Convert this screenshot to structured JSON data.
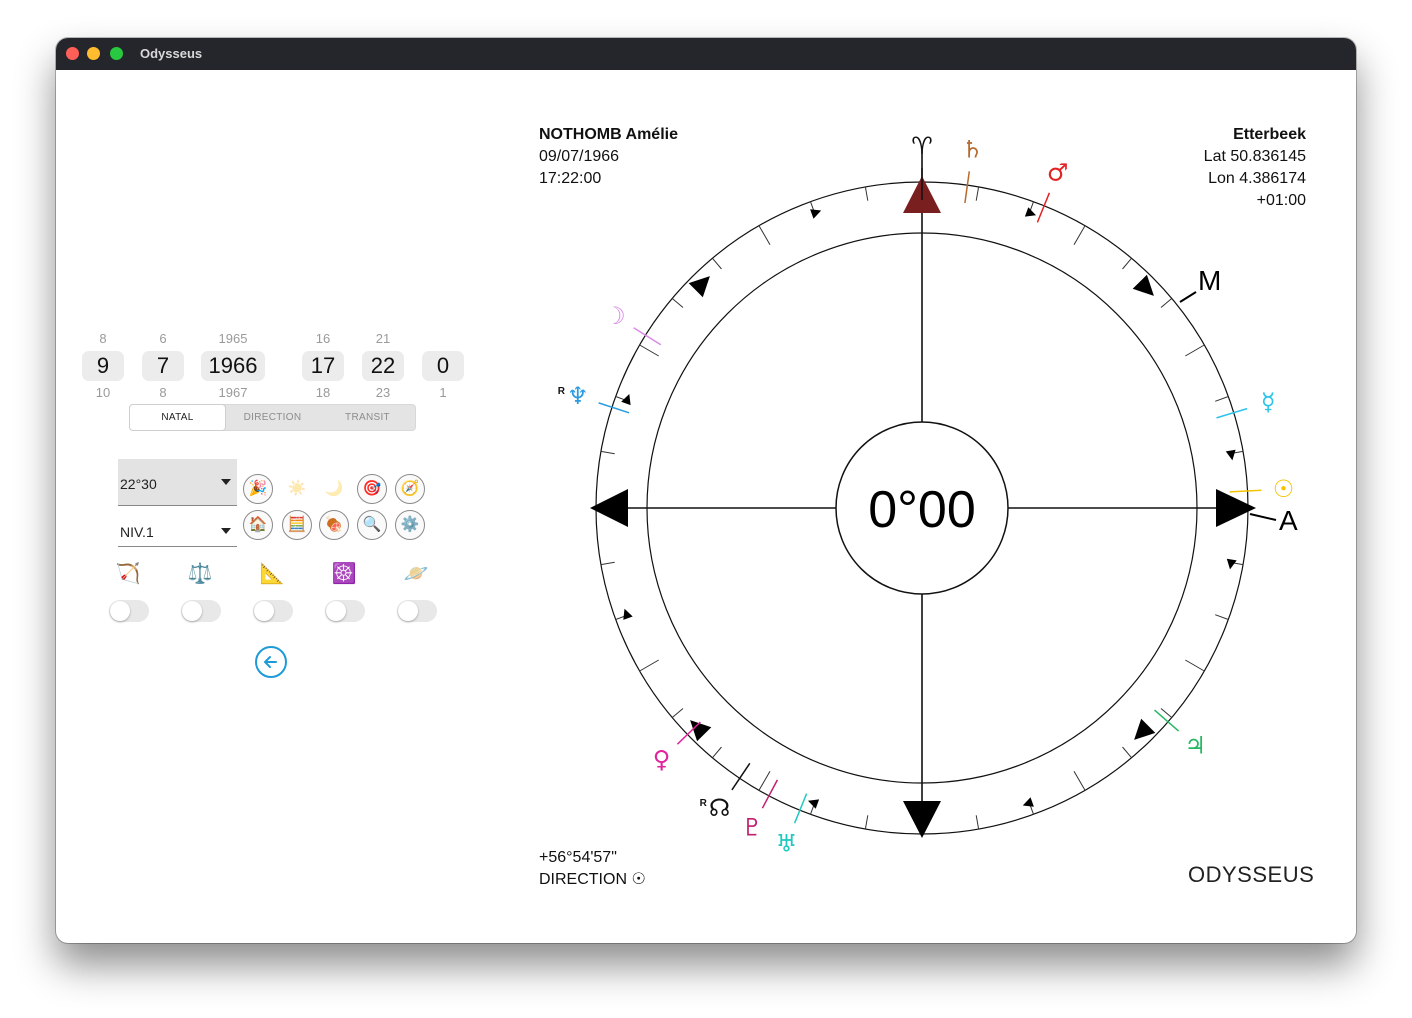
{
  "window": {
    "title": "Odysseus"
  },
  "pickers": [
    {
      "prev": "8",
      "current": "9",
      "next": "10"
    },
    {
      "prev": "6",
      "current": "7",
      "next": "8"
    },
    {
      "prev": "1965",
      "current": "1966",
      "next": "1967"
    },
    {
      "prev": "16",
      "current": "17",
      "next": "18"
    },
    {
      "prev": "21",
      "current": "22",
      "next": "23"
    },
    {
      "prev": "",
      "current": "0",
      "next": "1"
    }
  ],
  "mode_tabs": [
    {
      "label": "NATAL",
      "active": true
    },
    {
      "label": "DIRECTION",
      "active": false
    },
    {
      "label": "TRANSIT",
      "active": false
    }
  ],
  "orb_select": {
    "value": "22°30"
  },
  "level_select": {
    "value": "NIV.1"
  },
  "tool_icons": {
    "row1": [
      "party-popper-icon",
      "sun-icon",
      "moon-icon",
      "target-icon",
      "compass-icon"
    ],
    "row2": [
      "house-icon",
      "abacus-icon",
      "meat-icon",
      "magnifier-icon",
      "gear-icon"
    ]
  },
  "toggles": [
    {
      "icon": "bow-arrow-icon",
      "glyph": "🏹",
      "on": false
    },
    {
      "icon": "scales-icon",
      "glyph": "⚖️",
      "on": false
    },
    {
      "icon": "triangle-ruler-icon",
      "glyph": "📐",
      "on": false
    },
    {
      "icon": "wheel-icon",
      "glyph": "☸️",
      "on": false
    },
    {
      "icon": "ringed-planet-icon",
      "glyph": "🪐",
      "on": false
    }
  ],
  "back_button": {
    "icon": "arrow-left-icon",
    "color": "#1d9bd8"
  },
  "person": {
    "name": "NOTHOMB Amélie",
    "date": "09/07/1966",
    "time": "17:22:00"
  },
  "place": {
    "city": "Etterbeek",
    "lat": "Lat 50.836145",
    "lon": "Lon 4.386174",
    "tz": "+01:00"
  },
  "chart": {
    "center_label": "0°00",
    "arc_value": "+56°54'57\"",
    "mode_label": "DIRECTION ☉",
    "brand": "ODYSSEUS",
    "arrow_color": "#7a1f1f",
    "angle_labels": {
      "mc": "M",
      "asc": "A"
    },
    "planets": [
      {
        "name": "aries",
        "glyph": "♈",
        "color": "#111111",
        "angle": 0
      },
      {
        "name": "saturn",
        "glyph": "♄",
        "color": "#b86a2e",
        "angle": 8
      },
      {
        "name": "mars",
        "glyph": "♂",
        "color": "#e32222",
        "angle": 22
      },
      {
        "name": "moon",
        "glyph": "☽",
        "color": "#d98be6",
        "angle": -58
      },
      {
        "name": "neptune",
        "glyph": "♆",
        "color": "#2a9be0",
        "angle": -72,
        "retro": "R"
      },
      {
        "name": "mercury",
        "glyph": "☿",
        "color": "#2ec4e8",
        "angle": 73
      },
      {
        "name": "sun",
        "glyph": "☉",
        "color": "#f4c400",
        "angle": 87
      },
      {
        "name": "venus",
        "glyph": "♀",
        "color": "#e0259c",
        "angle": -134
      },
      {
        "name": "node",
        "glyph": "☊",
        "color": "#111111",
        "angle": -146,
        "retro": "R"
      },
      {
        "name": "pluto",
        "glyph": "♇",
        "color": "#c0206f",
        "angle": -152
      },
      {
        "name": "uranus",
        "glyph": "♅",
        "color": "#1fc9c0",
        "angle": -158
      },
      {
        "name": "jupiter",
        "glyph": "♃",
        "color": "#27b865",
        "angle": 131
      }
    ]
  }
}
